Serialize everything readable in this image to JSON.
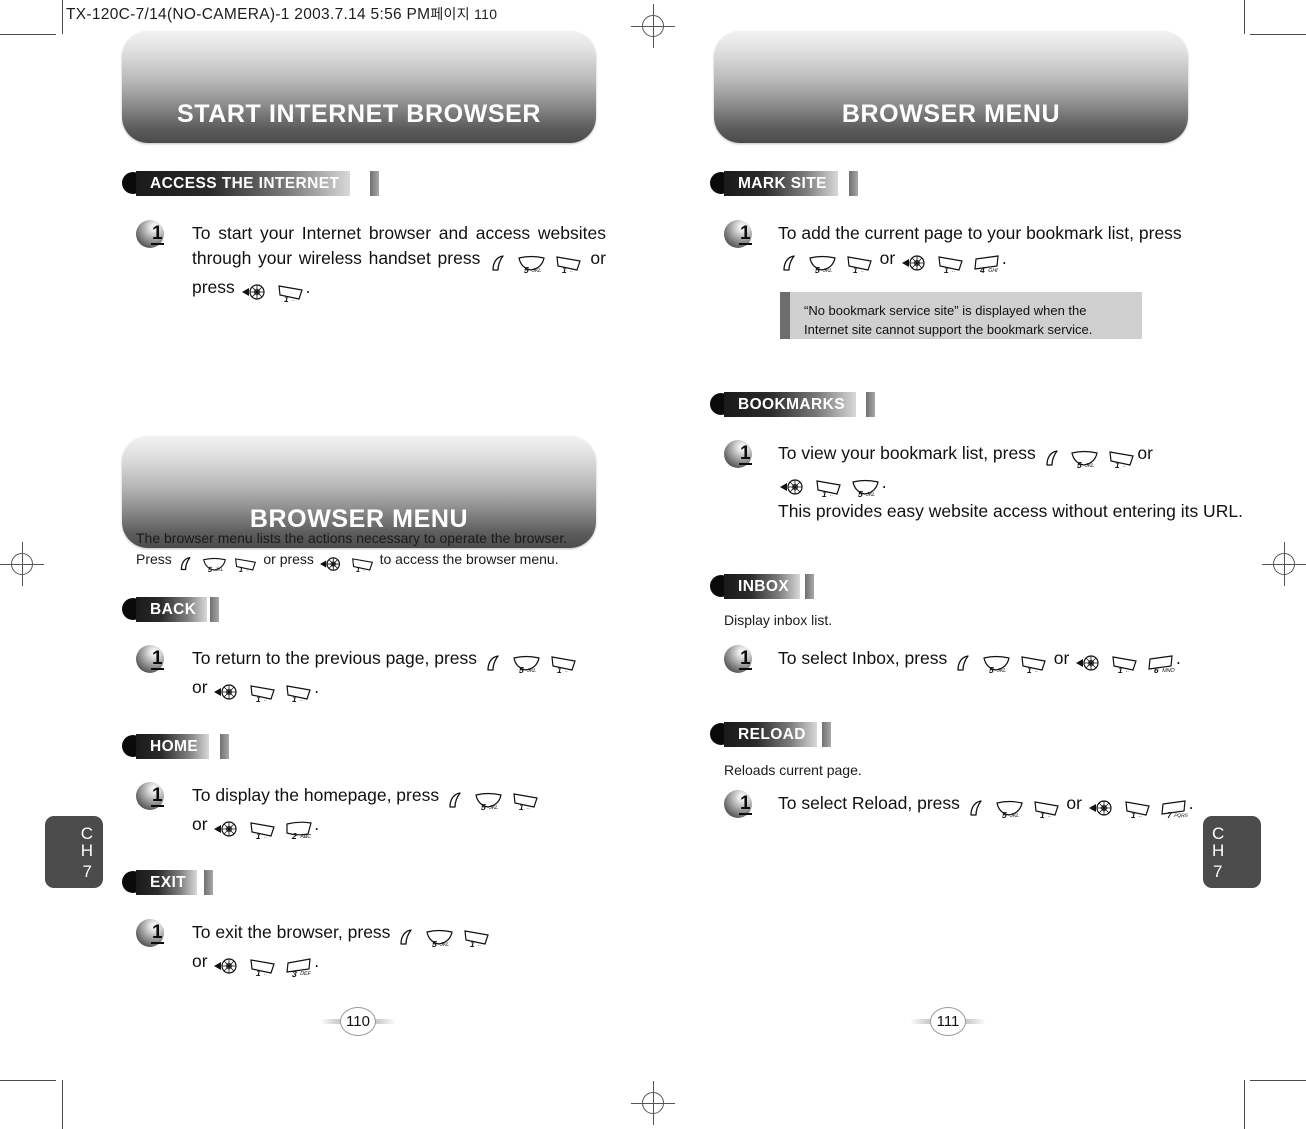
{
  "slug": {
    "text": "TX-120C-7/14(NO-CAMERA)-1  2003.7.14 5:56 PM",
    "korean": "페이지 110"
  },
  "keys": {
    "soft": "soft-key-icon",
    "nav": "navigation-key-icon",
    "n1": "1",
    "n1sub": "..",
    "n2": "2",
    "n2sub": "ABC",
    "n3": "3",
    "n3sub": "DEF",
    "n4": "4",
    "n4sub": "GHI",
    "n5": "5",
    "n5sub": "JKL",
    "n6": "6",
    "n6sub": "MNO",
    "n7": "7",
    "n7sub": "PQRS"
  },
  "left_page": {
    "banner_title": "START INTERNET BROWSER",
    "section_access": {
      "label": "ACCESS THE INTERNET",
      "step_number": "1",
      "text_a": "To start your Internet browser and access websites through your wireless handset press",
      "text_b": "or press",
      "text_c": "."
    },
    "banner_title_2": "BROWSER MENU",
    "intro": {
      "line1": "The browser menu lists the actions necessary to operate the browser.",
      "line2_a": "Press",
      "line2_b": "or press",
      "line2_c": "to access the browser menu."
    },
    "section_back": {
      "label": "BACK",
      "step_number": "1",
      "text_a": "To return to the previous page, press",
      "text_b": "or",
      "text_c": "."
    },
    "section_home": {
      "label": "HOME",
      "step_number": "1",
      "text_a": "To display the homepage, press",
      "text_b": "or",
      "text_c": "."
    },
    "section_exit": {
      "label": "EXIT",
      "step_number": "1",
      "text_a": "To exit the browser, press",
      "text_b": "or",
      "text_c": "."
    },
    "chapter_tab": {
      "c": "C",
      "h": "H",
      "n": "7"
    },
    "page_number": "110"
  },
  "right_page": {
    "banner_title": "BROWSER MENU",
    "section_mark_site": {
      "label": "MARK SITE",
      "step_number": "1",
      "text_a": "To add the current page to your bookmark list, press",
      "text_b": "or",
      "text_c": ".",
      "note_line1": "“No bookmark service site” is displayed when the",
      "note_line2": "Internet site cannot support the bookmark service."
    },
    "section_bookmarks": {
      "label": "BOOKMARKS",
      "step_number": "1",
      "text_a": "To view your bookmark list, press",
      "text_b": "or",
      "text_c": ".",
      "text_d": "This provides easy website access without entering its URL."
    },
    "section_inbox": {
      "label": "INBOX",
      "description": "Display inbox list.",
      "step_number": "1",
      "text_a": "To select Inbox, press",
      "text_b": "or",
      "text_c": "."
    },
    "section_reload": {
      "label": "RELOAD",
      "description": "Reloads current page.",
      "step_number": "1",
      "text_a": "To select Reload, press",
      "text_b": "or",
      "text_c": "."
    },
    "chapter_tab": {
      "c": "C",
      "h": "H",
      "n": "7"
    },
    "page_number": "111"
  },
  "colors": {
    "banner_dark": "#4b4b4b",
    "banner_light": "#f2f2f2",
    "tab_gray": "#4b4b4b",
    "note_bg": "#cfcfcf",
    "note_spine": "#6e6e6e"
  }
}
